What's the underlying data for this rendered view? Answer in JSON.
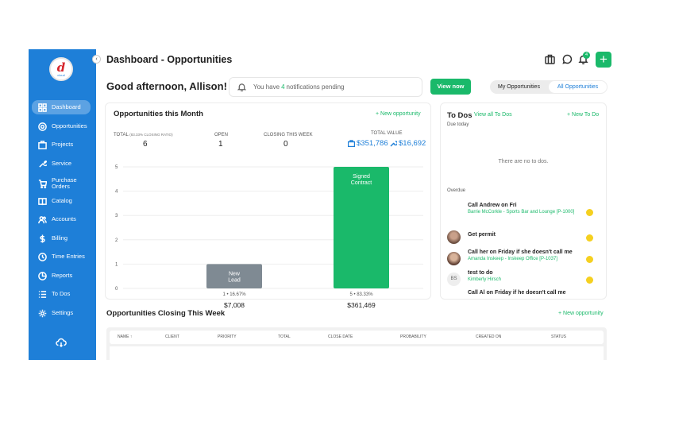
{
  "sidebar": {
    "logo_mark": "d",
    "logo_text": "cloud",
    "items": [
      {
        "label": "Dashboard",
        "icon": "dashboard-icon",
        "active": true
      },
      {
        "label": "Opportunities",
        "icon": "target-icon"
      },
      {
        "label": "Projects",
        "icon": "briefcase-icon"
      },
      {
        "label": "Service",
        "icon": "wrench-icon"
      },
      {
        "label": "Purchase Orders",
        "icon": "cart-icon"
      },
      {
        "label": "Catalog",
        "icon": "book-icon"
      },
      {
        "label": "Accounts",
        "icon": "users-icon"
      },
      {
        "label": "Billing",
        "icon": "dollar-icon"
      },
      {
        "label": "Time Entries",
        "icon": "clock-icon"
      },
      {
        "label": "Reports",
        "icon": "chart-icon"
      },
      {
        "label": "To Dos",
        "icon": "list-icon"
      },
      {
        "label": "Settings",
        "icon": "gear-icon"
      }
    ]
  },
  "header": {
    "title": "Dashboard - Opportunities",
    "bell_count": "4",
    "add_label": "+"
  },
  "greeting": "Good afternoon, Allison!",
  "notifications": {
    "prefix": "You have",
    "count": "4",
    "suffix": "notifications pending",
    "button": "View now"
  },
  "view_toggle": {
    "options": [
      "My Opportunities",
      "All Opportunities"
    ],
    "selected": "All Opportunities"
  },
  "opportunities": {
    "title": "Opportunities this Month",
    "new_link": "+ New opportunity",
    "stats": {
      "total_label": "TOTAL",
      "total_sub": "(83.33% CLOSING RATIO)",
      "total_value": "6",
      "open_label": "OPEN",
      "open_value": "1",
      "closing_label": "CLOSING THIS WEEK",
      "closing_value": "0",
      "total_value_label": "TOTAL VALUE",
      "value_projects": "$351,786",
      "value_service": "$16,692"
    }
  },
  "chart_data": {
    "type": "bar",
    "categories": [
      "New Lead",
      "Signed Contract"
    ],
    "values": [
      1,
      5
    ],
    "ylim": [
      0,
      5
    ],
    "yticks": [
      "0",
      "1",
      "2",
      "3",
      "4",
      "5"
    ],
    "bar_colors": [
      "#7f8a93",
      "#1ab96a"
    ],
    "notes": [
      "1 • 16.67%",
      "5 • 83.33%"
    ],
    "amounts": [
      "$7,008",
      "$361,469"
    ],
    "grid": true
  },
  "todos": {
    "title": "To Dos",
    "view_all": "View all To Dos",
    "new_link": "+ New To Do",
    "due_today_label": "Due today",
    "empty_message": "There are no to dos.",
    "overdue_label": "Overdue",
    "items": [
      {
        "title": "Call Andrew on Fri",
        "sub": "Barrie McCorkle - Sports Bar and Lounge [P-1000]",
        "avatar": ""
      },
      {
        "title": "Get permit",
        "sub": "",
        "avatar": ""
      },
      {
        "title": "Call her on Friday if she doesn't call me",
        "sub": "Amanda Inskeep - Inskeep Office [P-1037]",
        "avatar": ""
      },
      {
        "title": "test to do",
        "sub": "Kimberly Hirsch",
        "avatar": "BS"
      },
      {
        "title": "Call Al on Friday if he doesn't call me",
        "sub": "",
        "avatar": ""
      }
    ]
  },
  "closing_week": {
    "title": "Opportunities Closing This Week",
    "new_link": "+ New opportunity",
    "columns": [
      "NAME",
      "CLIENT",
      "PRIORITY",
      "TOTAL",
      "CLOSE DATE",
      "PROBABILITY",
      "CREATED ON",
      "STATUS"
    ],
    "sort_arrow": "↑"
  }
}
